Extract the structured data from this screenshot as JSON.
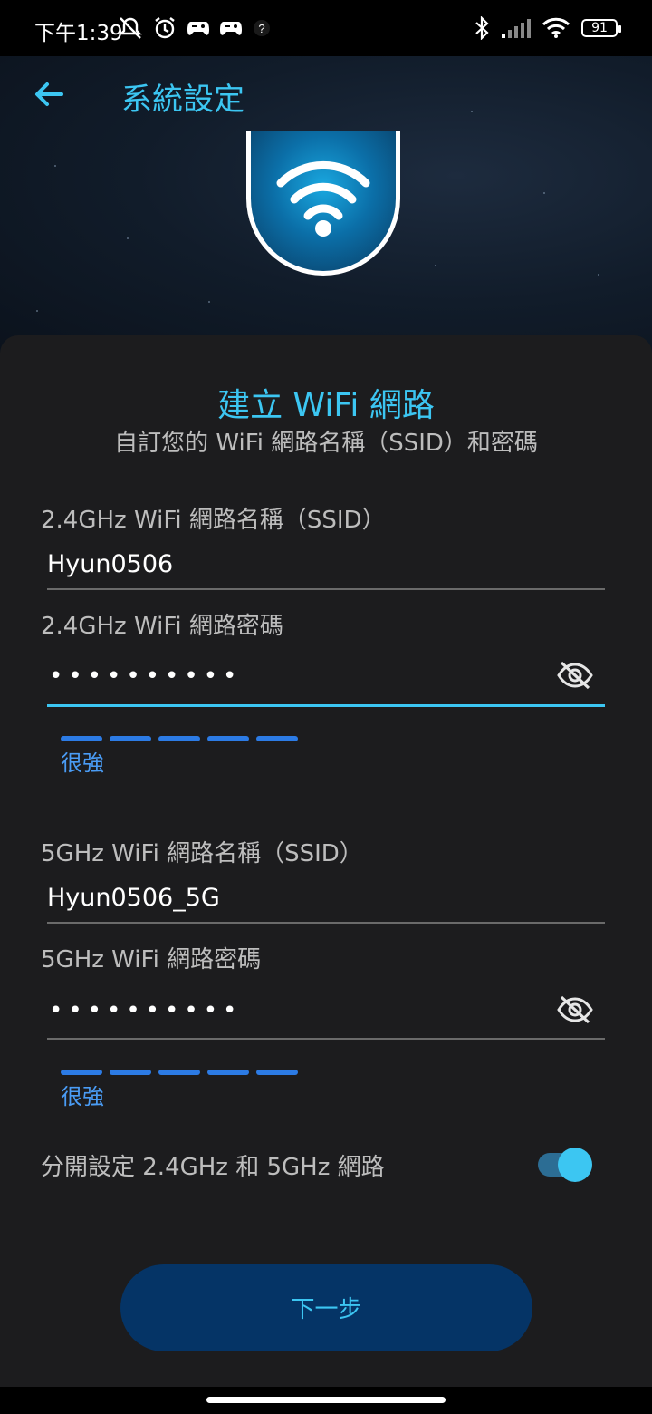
{
  "status_bar": {
    "time": "下午1:39",
    "battery": "91",
    "icons_left": [
      "mute-icon",
      "alarm-icon",
      "game-controller-icon",
      "game-controller-icon",
      "help-icon"
    ],
    "icons_right": [
      "bluetooth-icon",
      "signal-icon",
      "wifi-icon",
      "battery-icon"
    ]
  },
  "header": {
    "title": "系統設定",
    "back_icon": "arrow-left-icon"
  },
  "hero": {
    "icon": "wifi-icon"
  },
  "card": {
    "title": "建立 WiFi 網路",
    "subtitle": "自訂您的 WiFi 網路名稱（SSID）和密碼",
    "band_24": {
      "ssid_label": "2.4GHz WiFi 網路名稱（SSID）",
      "ssid_value": "Hyun0506",
      "password_label": "2.4GHz WiFi 網路密碼",
      "password_value": "••••••••••",
      "strength_text": "很強"
    },
    "band_5": {
      "ssid_label": "5GHz WiFi 網路名稱（SSID）",
      "ssid_value": "Hyun0506_5G",
      "password_label": "5GHz WiFi 網路密碼",
      "password_value": "••••••••••",
      "strength_text": "很強"
    },
    "separate_toggle": {
      "label": "分開設定 2.4GHz 和 5GHz 網路",
      "checked": true
    },
    "next_button": "下一步"
  },
  "colors": {
    "accent": "#3cc6f2",
    "button_bg": "#053466",
    "card_bg": "#1c1c1e",
    "strength": "#2c7be5"
  }
}
